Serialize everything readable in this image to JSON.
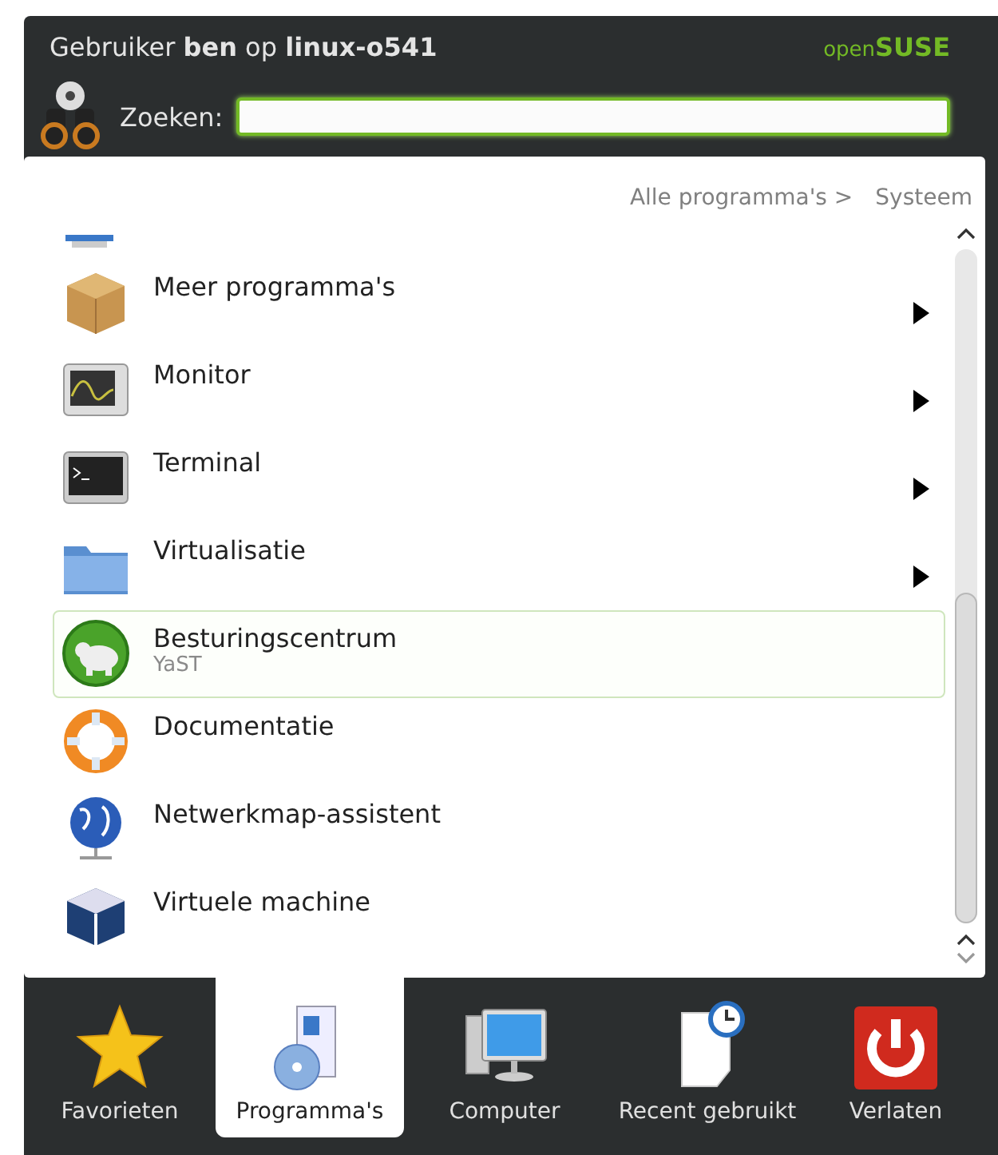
{
  "header": {
    "title": "Gebruiker **ben** op **linux-o541**",
    "logo": {
      "open": "open",
      "suse": "SUSE"
    }
  },
  "search": {
    "label": "Zoeken:"
  },
  "breadcrumb": [
    {
      "label": "Alle programma's >"
    },
    {
      "label": "Systeem"
    }
  ],
  "items": [
    {
      "kind": "submenu",
      "title": "Meer programma's",
      "selected": false
    },
    {
      "kind": "submenu",
      "title": "Monitor",
      "selected": false
    },
    {
      "kind": "submenu",
      "title": "Terminal",
      "selected": false
    },
    {
      "kind": "submenu",
      "title": "Virtualisatie",
      "selected": false
    },
    {
      "kind": "app",
      "title": "Besturingscentrum",
      "subtitle": "YaST",
      "selected": true
    },
    {
      "kind": "app",
      "title": "Documentatie",
      "selected": false
    },
    {
      "kind": "app",
      "title": "Netwerkmap-assistent",
      "selected": false
    },
    {
      "kind": "app",
      "title": "Virtuele machine",
      "selected": false
    }
  ],
  "tabs": [
    {
      "label": "Favorieten",
      "selected": false
    },
    {
      "label": "Programma's",
      "selected": true
    },
    {
      "label": "Computer",
      "selected": false
    },
    {
      "label": "Recent gebruikt",
      "selected": false
    },
    {
      "label": "Verlaten",
      "selected": false
    }
  ]
}
